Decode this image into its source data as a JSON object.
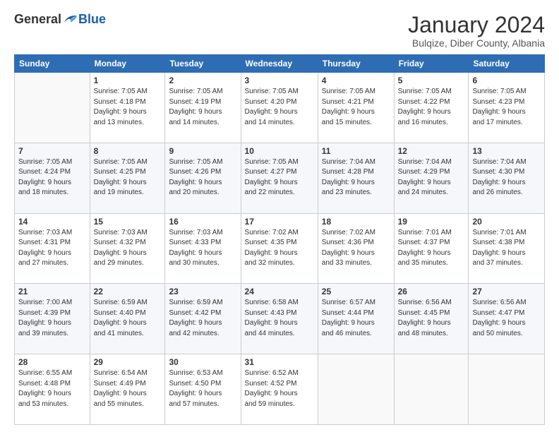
{
  "logo": {
    "general": "General",
    "blue": "Blue"
  },
  "title": "January 2024",
  "subtitle": "Bulqize, Diber County, Albania",
  "header_days": [
    "Sunday",
    "Monday",
    "Tuesday",
    "Wednesday",
    "Thursday",
    "Friday",
    "Saturday"
  ],
  "weeks": [
    [
      {
        "day": "",
        "info": ""
      },
      {
        "day": "1",
        "info": "Sunrise: 7:05 AM\nSunset: 4:18 PM\nDaylight: 9 hours\nand 13 minutes."
      },
      {
        "day": "2",
        "info": "Sunrise: 7:05 AM\nSunset: 4:19 PM\nDaylight: 9 hours\nand 14 minutes."
      },
      {
        "day": "3",
        "info": "Sunrise: 7:05 AM\nSunset: 4:20 PM\nDaylight: 9 hours\nand 14 minutes."
      },
      {
        "day": "4",
        "info": "Sunrise: 7:05 AM\nSunset: 4:21 PM\nDaylight: 9 hours\nand 15 minutes."
      },
      {
        "day": "5",
        "info": "Sunrise: 7:05 AM\nSunset: 4:22 PM\nDaylight: 9 hours\nand 16 minutes."
      },
      {
        "day": "6",
        "info": "Sunrise: 7:05 AM\nSunset: 4:23 PM\nDaylight: 9 hours\nand 17 minutes."
      }
    ],
    [
      {
        "day": "7",
        "info": "Sunrise: 7:05 AM\nSunset: 4:24 PM\nDaylight: 9 hours\nand 18 minutes."
      },
      {
        "day": "8",
        "info": "Sunrise: 7:05 AM\nSunset: 4:25 PM\nDaylight: 9 hours\nand 19 minutes."
      },
      {
        "day": "9",
        "info": "Sunrise: 7:05 AM\nSunset: 4:26 PM\nDaylight: 9 hours\nand 20 minutes."
      },
      {
        "day": "10",
        "info": "Sunrise: 7:05 AM\nSunset: 4:27 PM\nDaylight: 9 hours\nand 22 minutes."
      },
      {
        "day": "11",
        "info": "Sunrise: 7:04 AM\nSunset: 4:28 PM\nDaylight: 9 hours\nand 23 minutes."
      },
      {
        "day": "12",
        "info": "Sunrise: 7:04 AM\nSunset: 4:29 PM\nDaylight: 9 hours\nand 24 minutes."
      },
      {
        "day": "13",
        "info": "Sunrise: 7:04 AM\nSunset: 4:30 PM\nDaylight: 9 hours\nand 26 minutes."
      }
    ],
    [
      {
        "day": "14",
        "info": "Sunrise: 7:03 AM\nSunset: 4:31 PM\nDaylight: 9 hours\nand 27 minutes."
      },
      {
        "day": "15",
        "info": "Sunrise: 7:03 AM\nSunset: 4:32 PM\nDaylight: 9 hours\nand 29 minutes."
      },
      {
        "day": "16",
        "info": "Sunrise: 7:03 AM\nSunset: 4:33 PM\nDaylight: 9 hours\nand 30 minutes."
      },
      {
        "day": "17",
        "info": "Sunrise: 7:02 AM\nSunset: 4:35 PM\nDaylight: 9 hours\nand 32 minutes."
      },
      {
        "day": "18",
        "info": "Sunrise: 7:02 AM\nSunset: 4:36 PM\nDaylight: 9 hours\nand 33 minutes."
      },
      {
        "day": "19",
        "info": "Sunrise: 7:01 AM\nSunset: 4:37 PM\nDaylight: 9 hours\nand 35 minutes."
      },
      {
        "day": "20",
        "info": "Sunrise: 7:01 AM\nSunset: 4:38 PM\nDaylight: 9 hours\nand 37 minutes."
      }
    ],
    [
      {
        "day": "21",
        "info": "Sunrise: 7:00 AM\nSunset: 4:39 PM\nDaylight: 9 hours\nand 39 minutes."
      },
      {
        "day": "22",
        "info": "Sunrise: 6:59 AM\nSunset: 4:40 PM\nDaylight: 9 hours\nand 41 minutes."
      },
      {
        "day": "23",
        "info": "Sunrise: 6:59 AM\nSunset: 4:42 PM\nDaylight: 9 hours\nand 42 minutes."
      },
      {
        "day": "24",
        "info": "Sunrise: 6:58 AM\nSunset: 4:43 PM\nDaylight: 9 hours\nand 44 minutes."
      },
      {
        "day": "25",
        "info": "Sunrise: 6:57 AM\nSunset: 4:44 PM\nDaylight: 9 hours\nand 46 minutes."
      },
      {
        "day": "26",
        "info": "Sunrise: 6:56 AM\nSunset: 4:45 PM\nDaylight: 9 hours\nand 48 minutes."
      },
      {
        "day": "27",
        "info": "Sunrise: 6:56 AM\nSunset: 4:47 PM\nDaylight: 9 hours\nand 50 minutes."
      }
    ],
    [
      {
        "day": "28",
        "info": "Sunrise: 6:55 AM\nSunset: 4:48 PM\nDaylight: 9 hours\nand 53 minutes."
      },
      {
        "day": "29",
        "info": "Sunrise: 6:54 AM\nSunset: 4:49 PM\nDaylight: 9 hours\nand 55 minutes."
      },
      {
        "day": "30",
        "info": "Sunrise: 6:53 AM\nSunset: 4:50 PM\nDaylight: 9 hours\nand 57 minutes."
      },
      {
        "day": "31",
        "info": "Sunrise: 6:52 AM\nSunset: 4:52 PM\nDaylight: 9 hours\nand 59 minutes."
      },
      {
        "day": "",
        "info": ""
      },
      {
        "day": "",
        "info": ""
      },
      {
        "day": "",
        "info": ""
      }
    ]
  ]
}
